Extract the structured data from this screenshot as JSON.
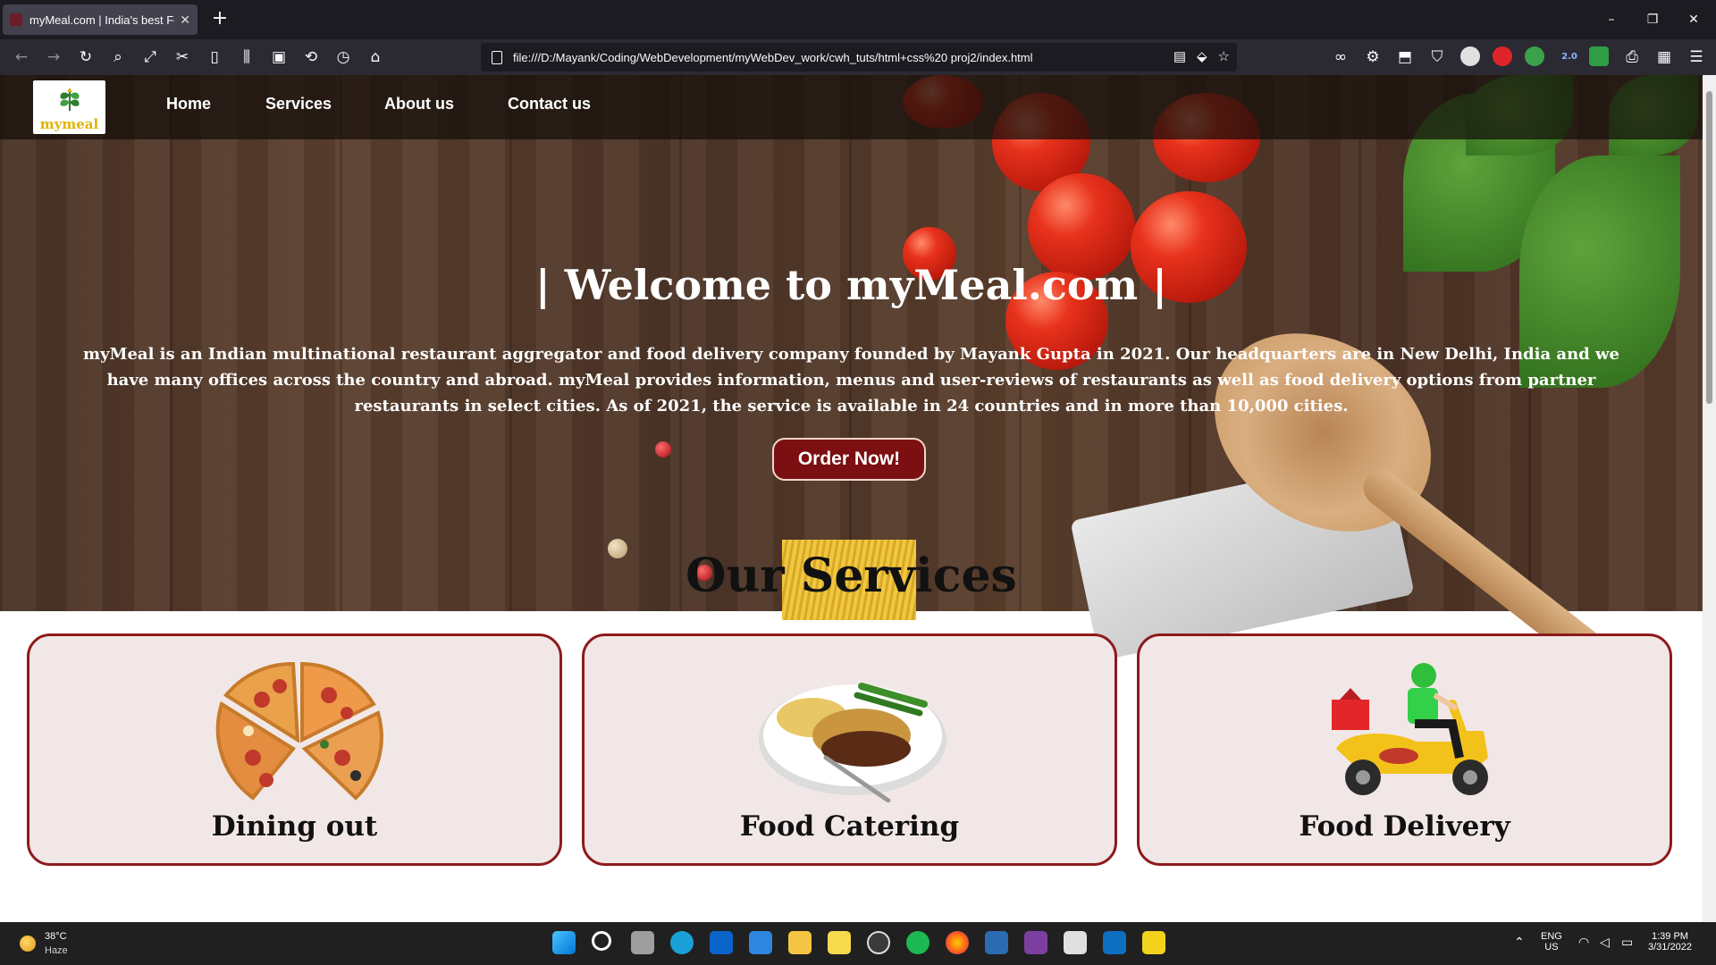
{
  "browser": {
    "tab_title": "myMeal.com | India's best Food",
    "tab_close": "✕",
    "new_tab": "+",
    "url": "file:///D:/Mayank/Coding/WebDevelopment/myWebDev_work/cwh_tuts/html+css%20 proj2/index.html",
    "window_controls": [
      "–",
      "❐",
      "✕"
    ],
    "ext_badge": "2.0"
  },
  "site": {
    "logo_word": "mymeal",
    "nav": [
      "Home",
      "Services",
      "About us",
      "Contact us"
    ],
    "hero_title": "| Welcome to myMeal.com |",
    "hero_desc": "myMeal is an Indian multinational restaurant aggregator and food delivery company founded by Mayank Gupta in 2021. Our headquarters are in New Delhi, India and we have many offices across the country and abroad. myMeal provides information, menus and user-reviews of restaurants as well as food delivery options from partner restaurants in select cities. As of 2021, the service is available in 24 countries and in more than 10,000 cities.",
    "order_button": "Order Now!",
    "services_title": "Our Services",
    "services": [
      {
        "name": "Dining out",
        "image": "pizza-image"
      },
      {
        "name": "Food Catering",
        "image": "plate-image"
      },
      {
        "name": "Food Delivery",
        "image": "scooter-image"
      }
    ]
  },
  "taskbar": {
    "temperature": "38°C",
    "weather": "Haze",
    "language": "ENG",
    "region": "US",
    "time": "1:39 PM",
    "date": "3/31/2022"
  },
  "colors": {
    "accent": "#7b0f12",
    "card_border": "#8d1a1c",
    "card_bg": "#f2e7e7",
    "logo_gold": "#e0b400"
  }
}
